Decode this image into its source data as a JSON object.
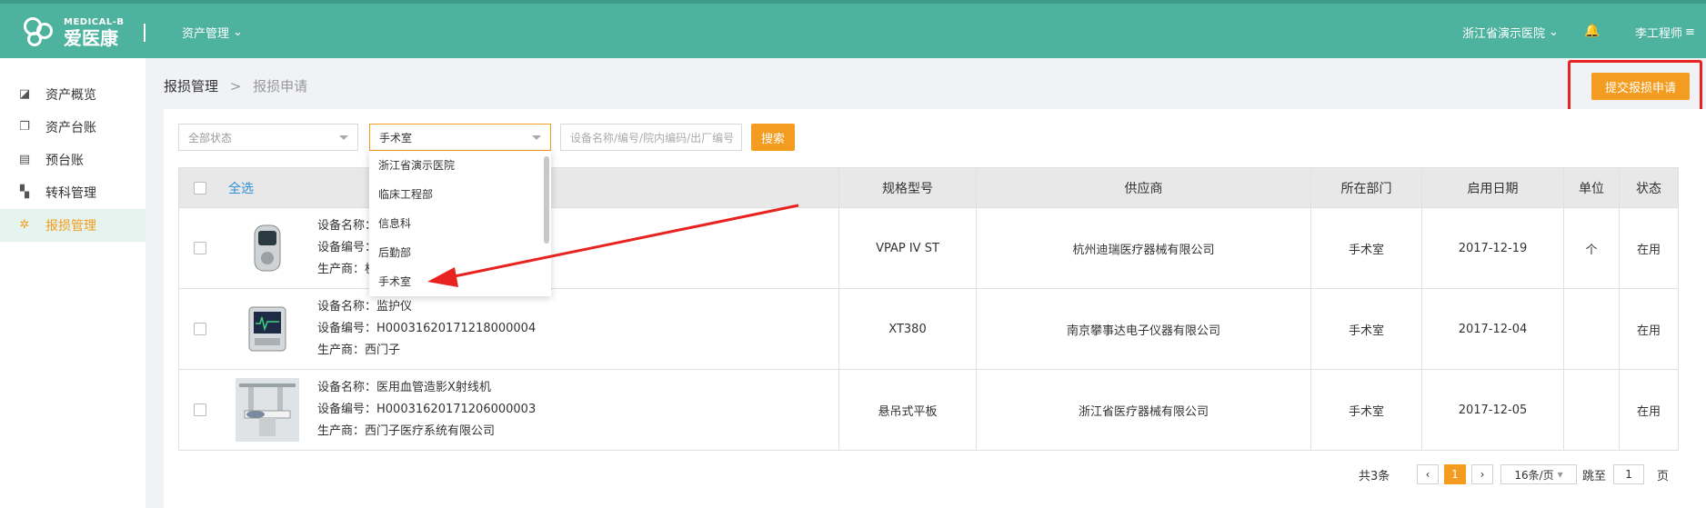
{
  "header": {
    "logo_en": "MEDICAL-B",
    "logo_cn": "爱医康",
    "asset_menu": "资产管理",
    "hospital": "浙江省演示医院",
    "user": "李工程师",
    "bar_color": "#4db39e"
  },
  "sidebar": {
    "items": [
      {
        "label": "资产概览",
        "icon": "chart-icon"
      },
      {
        "label": "资产台账",
        "icon": "copy-icon"
      },
      {
        "label": "预台账",
        "icon": "document-icon"
      },
      {
        "label": "转科管理",
        "icon": "transfer-icon"
      },
      {
        "label": "报损管理",
        "icon": "gear-icon",
        "active": true
      }
    ]
  },
  "breadcrumb": {
    "parent": "报损管理",
    "sep": ">",
    "current": "报损申请"
  },
  "submit_button": "提交报损申请",
  "filters": {
    "status_placeholder": "全部状态",
    "dept_value": "手术室",
    "search_placeholder": "设备名称/编号/院内编码/出厂编号",
    "search_button": "搜索"
  },
  "dropdown": {
    "options": [
      "浙江省演示医院",
      "临床工程部",
      "信息科",
      "后勤部",
      "手术室"
    ]
  },
  "table": {
    "headers": {
      "select_all": "全选",
      "spec": "规格型号",
      "supplier": "供应商",
      "dept": "所在部门",
      "date": "启用日期",
      "unit": "单位",
      "status": "状态"
    },
    "labels": {
      "name": "设备名称：",
      "code": "设备编号：",
      "maker": "生产商："
    },
    "rows": [
      {
        "name": "",
        "code": "",
        "maker": "杭",
        "spec": "VPAP IV ST",
        "supplier": "杭州迪瑞医疗器械有限公司",
        "dept": "手术室",
        "date": "2017-12-19",
        "unit": "个",
        "status": "在用"
      },
      {
        "name": "监护仪",
        "code": "H00031620171218000004",
        "maker": "西门子",
        "spec": "XT380",
        "supplier": "南京攀事达电子仪器有限公司",
        "dept": "手术室",
        "date": "2017-12-04",
        "unit": "",
        "status": "在用"
      },
      {
        "name": "医用血管造影X射线机",
        "code": "H00031620171206000003",
        "maker": "西门子医疗系统有限公司",
        "spec": "悬吊式平板",
        "supplier": "浙江省医疗器械有限公司",
        "dept": "手术室",
        "date": "2017-12-05",
        "unit": "",
        "status": "在用"
      }
    ]
  },
  "pagination": {
    "total": "共3条",
    "prev": "‹",
    "page": "1",
    "next": "›",
    "page_size": "16条/页",
    "jump_label": "跳至",
    "jump_value": "1",
    "page_suffix": "页"
  },
  "colors": {
    "accent": "#f39c1f",
    "annotation_red": "#e8221e"
  }
}
